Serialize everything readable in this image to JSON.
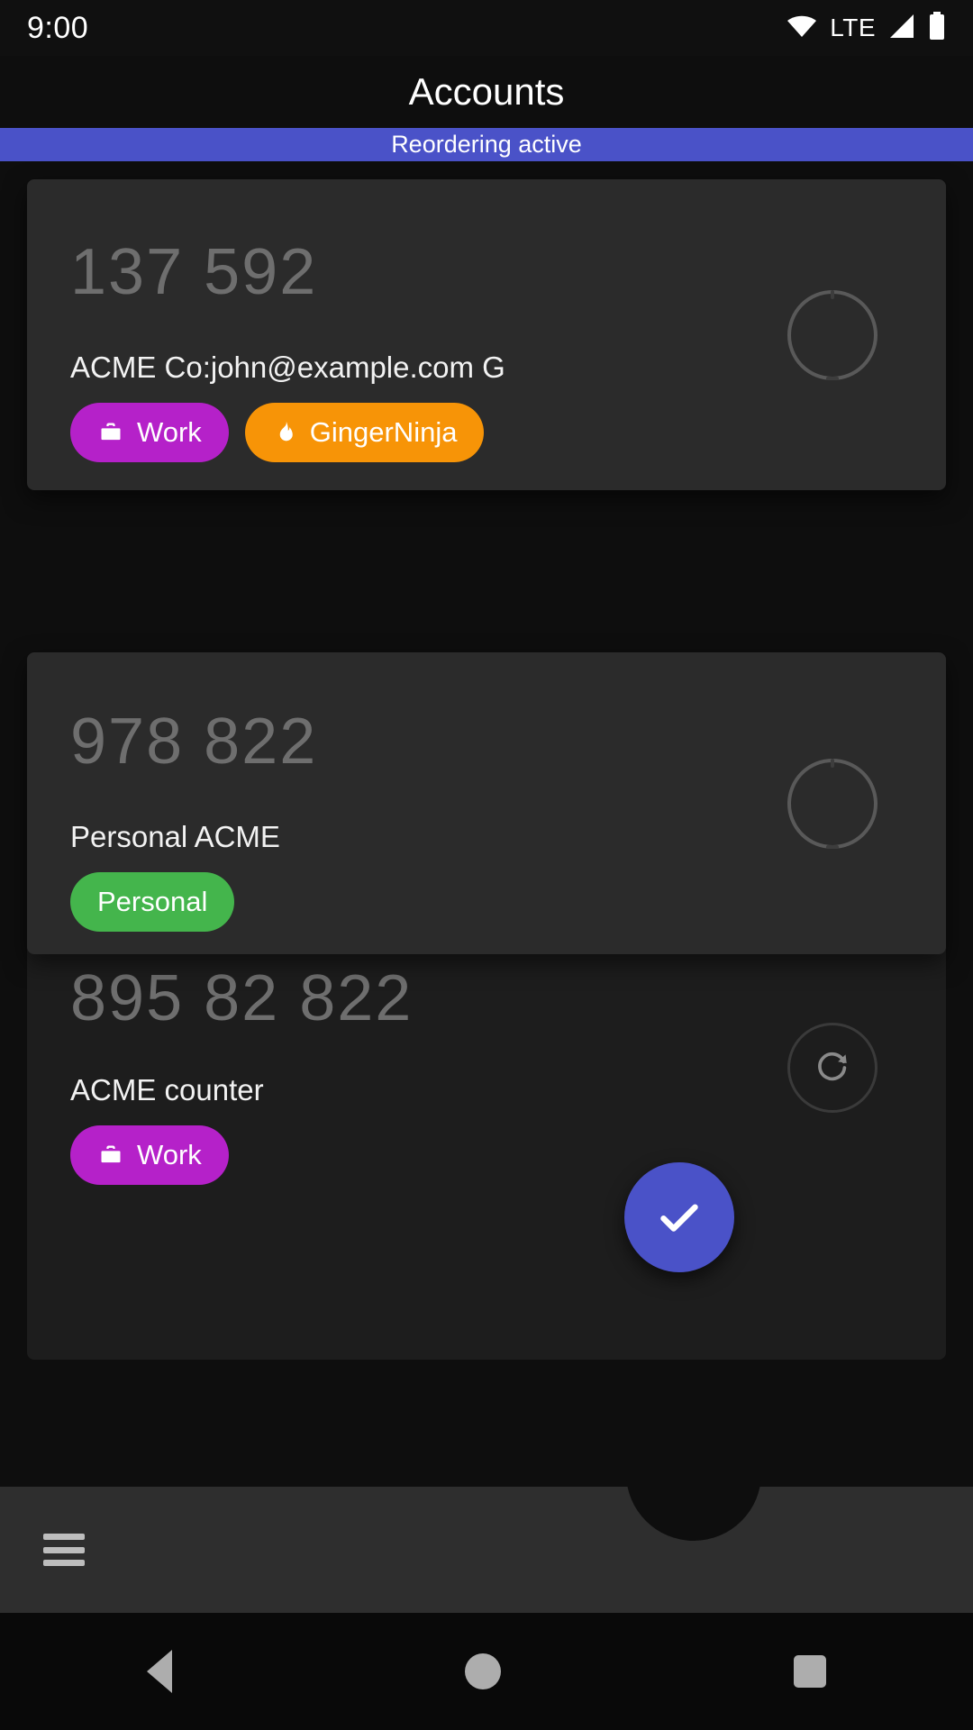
{
  "status_bar": {
    "time": "9:00",
    "network_label": "LTE",
    "icons": [
      "wifi-icon",
      "signal-icon",
      "battery-icon"
    ]
  },
  "app_bar": {
    "title": "Accounts"
  },
  "banner": {
    "text": "Reordering active",
    "color": "#4a52c8"
  },
  "accounts": [
    {
      "code": "137 592",
      "label": "ACME Co:john@example.com G",
      "indicator": "countdown-ring",
      "chips": [
        {
          "text": "Work",
          "color": "#b521c9",
          "icon": "briefcase-icon"
        },
        {
          "text": "GingerNinja",
          "color": "#f79407",
          "icon": "flame-icon"
        }
      ]
    },
    {
      "code": "978 822",
      "label": "Personal ACME",
      "indicator": "countdown-ring",
      "chips": [
        {
          "text": "Personal",
          "color": "#44b54c",
          "icon": "none"
        }
      ]
    },
    {
      "code": "895 82 822",
      "label": "ACME counter",
      "indicator": "refresh-button",
      "chips": [
        {
          "text": "Work",
          "color": "#b521c9",
          "icon": "briefcase-icon"
        }
      ]
    }
  ],
  "bottom_bar": {
    "menu_icon": "hamburger-menu-icon",
    "fab": {
      "icon": "check-icon",
      "color": "#4a52c8"
    }
  },
  "nav_bar": {
    "back": "back-triangle-icon",
    "home": "home-circle-icon",
    "recents": "recents-square-icon"
  }
}
